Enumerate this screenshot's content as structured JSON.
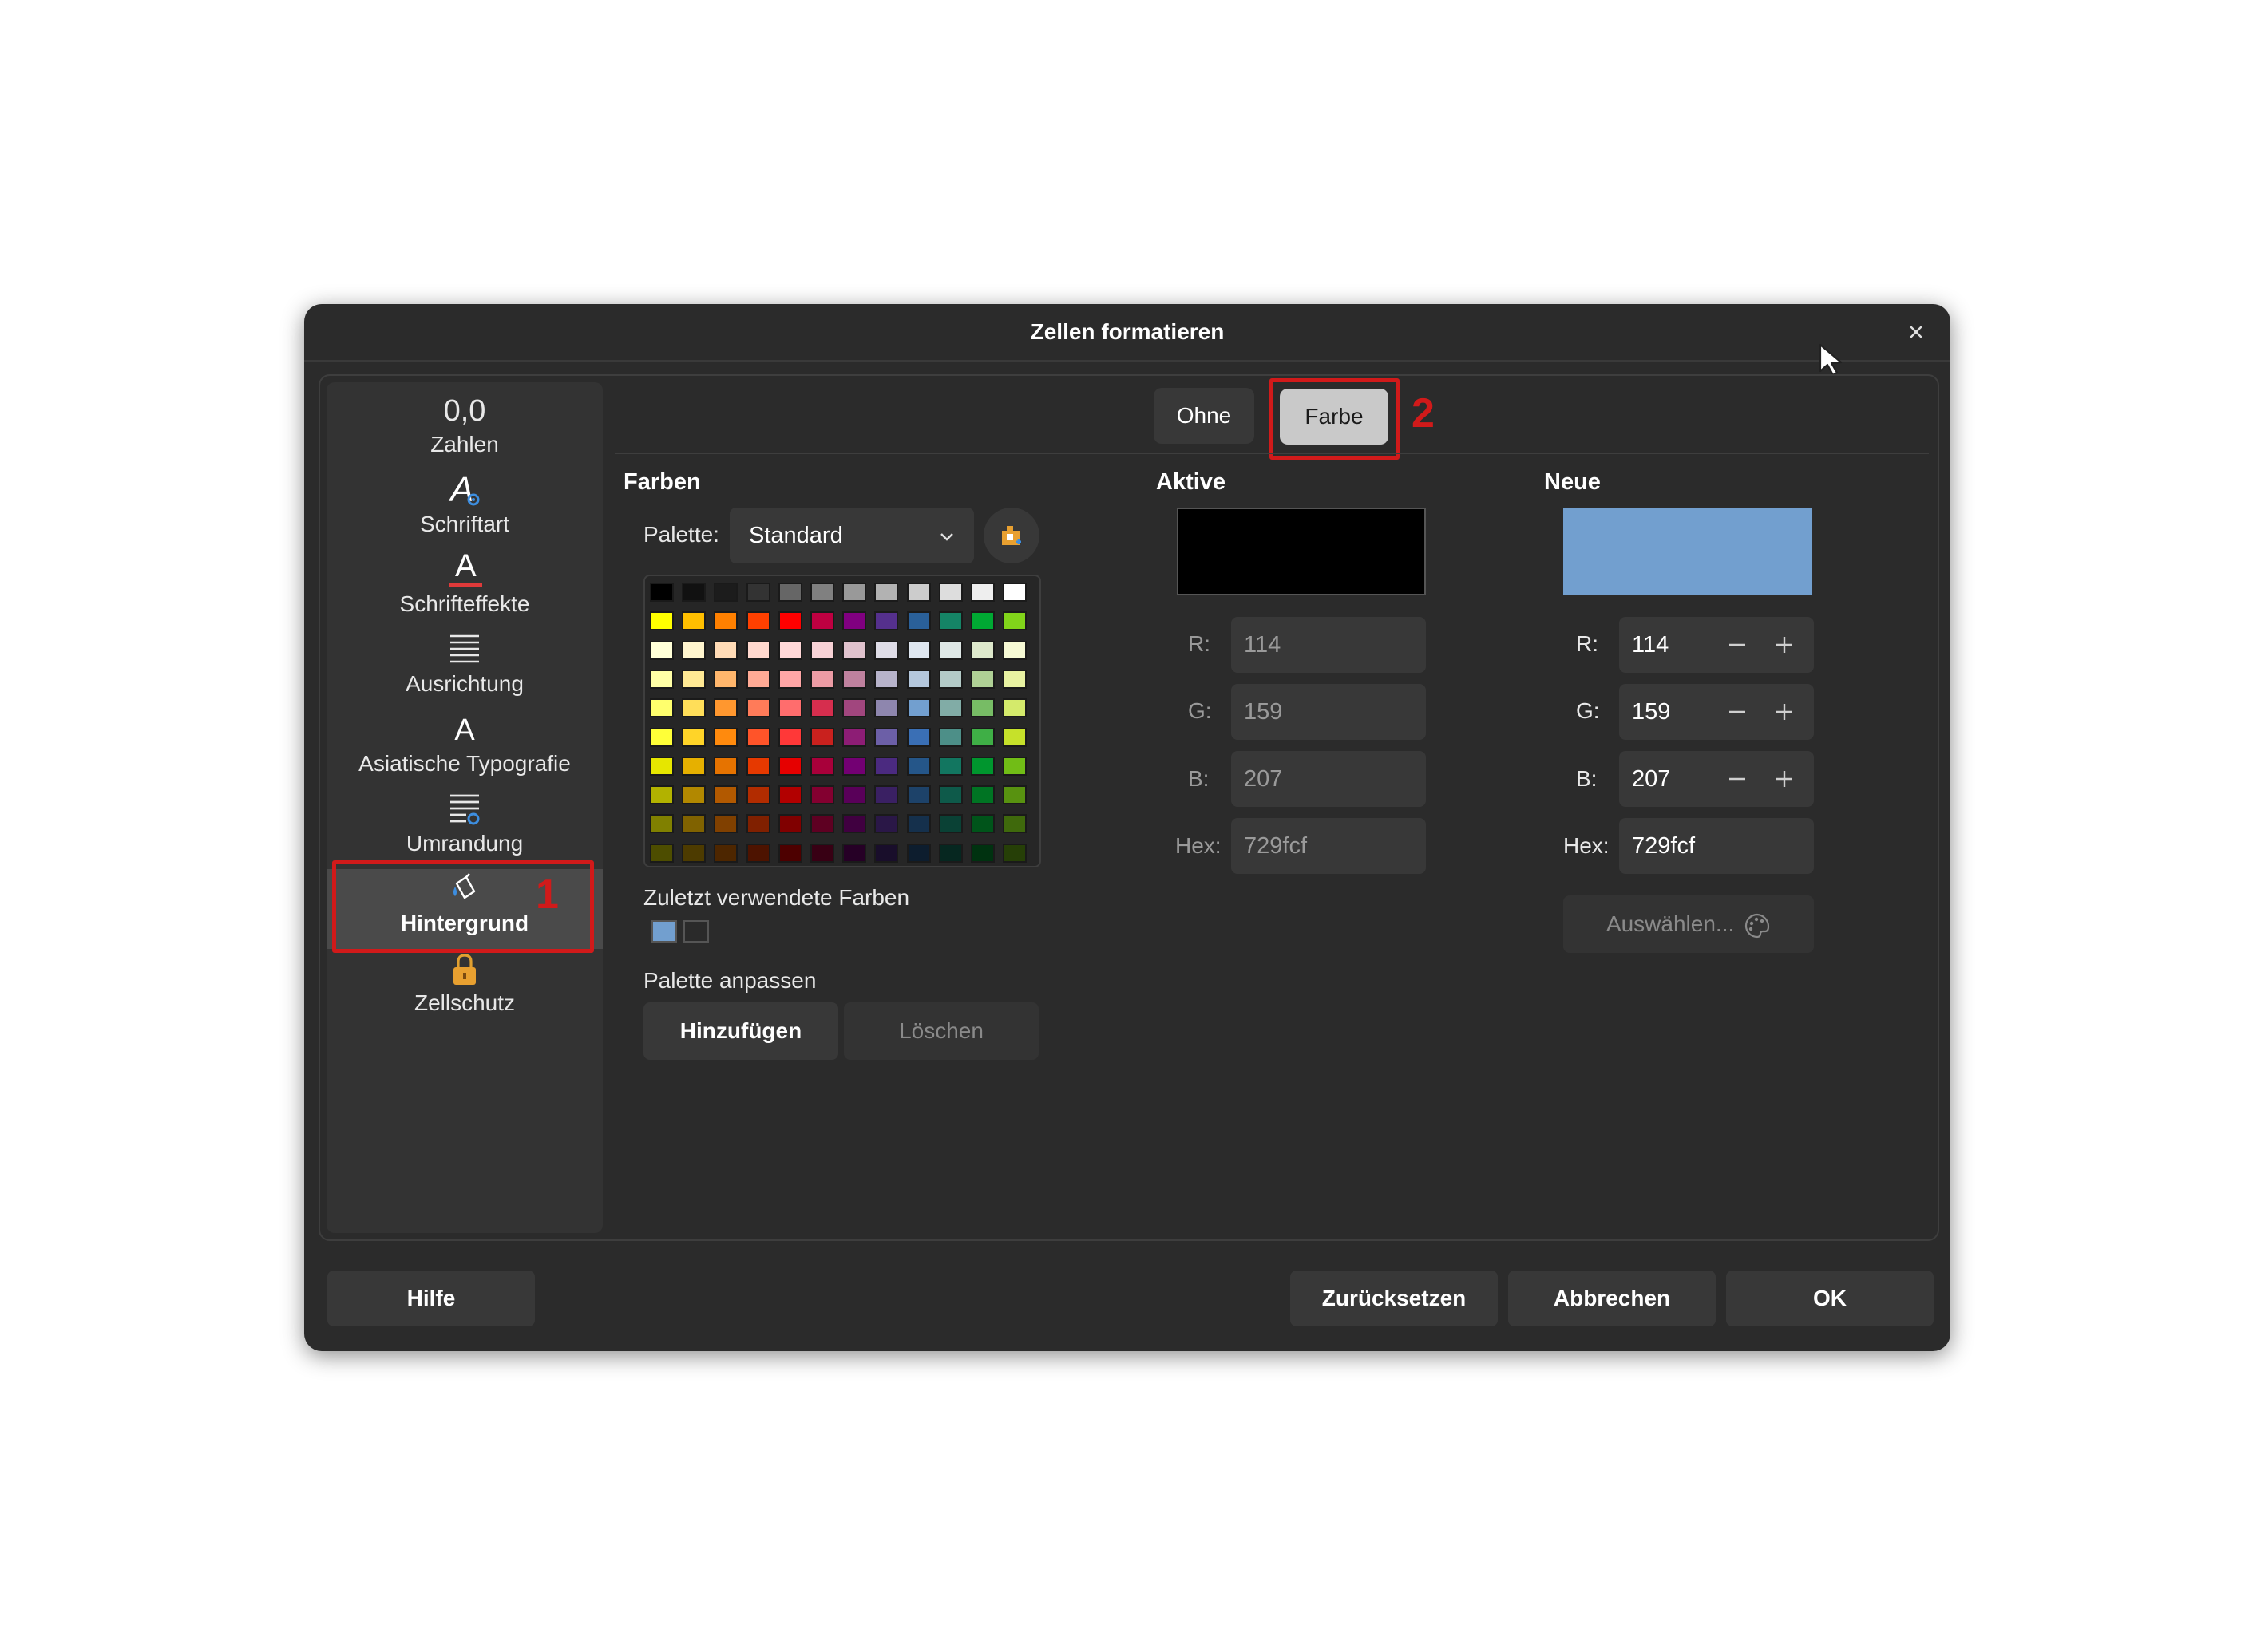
{
  "dialog": {
    "title": "Zellen formatieren"
  },
  "sidebar": {
    "items": [
      {
        "label": "Zahlen",
        "icon": "number-format-icon",
        "selected": false
      },
      {
        "label": "Schriftart",
        "icon": "font-icon",
        "selected": false
      },
      {
        "label": "Schrifteffekte",
        "icon": "font-effects-icon",
        "selected": false
      },
      {
        "label": "Ausrichtung",
        "icon": "alignment-icon",
        "selected": false
      },
      {
        "label": "Asiatische Typografie",
        "icon": "asian-typography-icon",
        "selected": false
      },
      {
        "label": "Umrandung",
        "icon": "borders-icon",
        "selected": false
      },
      {
        "label": "Hintergrund",
        "icon": "paint-bucket-icon",
        "selected": true
      },
      {
        "label": "Zellschutz",
        "icon": "lock-icon",
        "selected": false
      }
    ],
    "icon_glyphs": {
      "zahlen": "0,0",
      "schriftart": "A",
      "schrifteffekte": "A",
      "asiatisch": "A"
    }
  },
  "annotations": {
    "first": "1",
    "second": "2",
    "color": "#d11a1a"
  },
  "tabs": {
    "none_label": "Ohne",
    "color_label": "Farbe",
    "active": "Farbe"
  },
  "farben": {
    "title": "Farben",
    "palette_label": "Palette:",
    "palette_value": "Standard",
    "recent_title": "Zuletzt verwendete Farben",
    "recent_colors": [
      "#729fcf",
      "#2a2a2a"
    ],
    "customize_title": "Palette anpassen",
    "add_label": "Hinzufügen",
    "delete_label": "Löschen"
  },
  "palette_colors": [
    [
      "#000000",
      "#111111",
      "#1c1c1c",
      "#333333",
      "#666666",
      "#808080",
      "#999999",
      "#b2b2b2",
      "#cccccc",
      "#dddddd",
      "#eeeeee",
      "#ffffff"
    ],
    [
      "#ffff00",
      "#ffbf00",
      "#ff8000",
      "#ff4000",
      "#ff0000",
      "#bf0041",
      "#800080",
      "#55308d",
      "#2a6099",
      "#158466",
      "#00a933",
      "#81d41a"
    ],
    [
      "#ffffd7",
      "#fff5ce",
      "#ffdbb6",
      "#ffd8ce",
      "#ffd7d7",
      "#f7d1d5",
      "#e0c2cd",
      "#dedce6",
      "#dee6ef",
      "#dee7e5",
      "#dde8cb",
      "#f6f9d4"
    ],
    [
      "#ffffa6",
      "#ffe994",
      "#ffb66c",
      "#ffaa95",
      "#ffa6a6",
      "#ec9ba4",
      "#bf819e",
      "#b7b3ca",
      "#b4c7dc",
      "#b3cac7",
      "#afd095",
      "#e8f2a1"
    ],
    [
      "#ffff6d",
      "#ffde59",
      "#ff972f",
      "#ff7b59",
      "#ff6d6d",
      "#d62e4e",
      "#a1467e",
      "#8e86ae",
      "#729fcf",
      "#81aca6",
      "#77bc65",
      "#d4ea6b"
    ],
    [
      "#ffff38",
      "#ffd428",
      "#ff8a0d",
      "#ff5429",
      "#ff3838",
      "#c9211e",
      "#8d1d75",
      "#6c5fa7",
      "#3a6fb5",
      "#4d8f88",
      "#3faf46",
      "#c6e12a"
    ],
    [
      "#e6e600",
      "#e6b000",
      "#e67300",
      "#e63900",
      "#e60000",
      "#a8003a",
      "#730073",
      "#4b2a80",
      "#255689",
      "#127660",
      "#00962e",
      "#71bd16"
    ],
    [
      "#b2b200",
      "#b28800",
      "#b25900",
      "#b22c00",
      "#b20000",
      "#830030",
      "#590059",
      "#3a2063",
      "#1d4269",
      "#0e5a4a",
      "#007423",
      "#589210"
    ],
    [
      "#808000",
      "#806200",
      "#804000",
      "#802000",
      "#800000",
      "#5e0022",
      "#400040",
      "#2a1747",
      "#15304c",
      "#0a4135",
      "#00541a",
      "#3f690c"
    ],
    [
      "#4d4d00",
      "#4d3b00",
      "#4d2600",
      "#4d1300",
      "#4d0000",
      "#380014",
      "#260026",
      "#190e2b",
      "#0d1d2e",
      "#062720",
      "#003210",
      "#263f07"
    ]
  ],
  "aktive": {
    "title": "Aktive",
    "color": "#000000",
    "r_label": "R:",
    "r_value": "114",
    "g_label": "G:",
    "g_value": "159",
    "b_label": "B:",
    "b_value": "207",
    "hex_label": "Hex:",
    "hex_value": "729fcf"
  },
  "neue": {
    "title": "Neue",
    "color": "#729fcf",
    "r_label": "R:",
    "r_value": "114",
    "g_label": "G:",
    "g_value": "159",
    "b_label": "B:",
    "b_value": "207",
    "hex_label": "Hex:",
    "hex_value": "729fcf",
    "pick_label": "Auswählen..."
  },
  "footer": {
    "help": "Hilfe",
    "reset": "Zurücksetzen",
    "cancel": "Abbrechen",
    "ok": "OK"
  }
}
